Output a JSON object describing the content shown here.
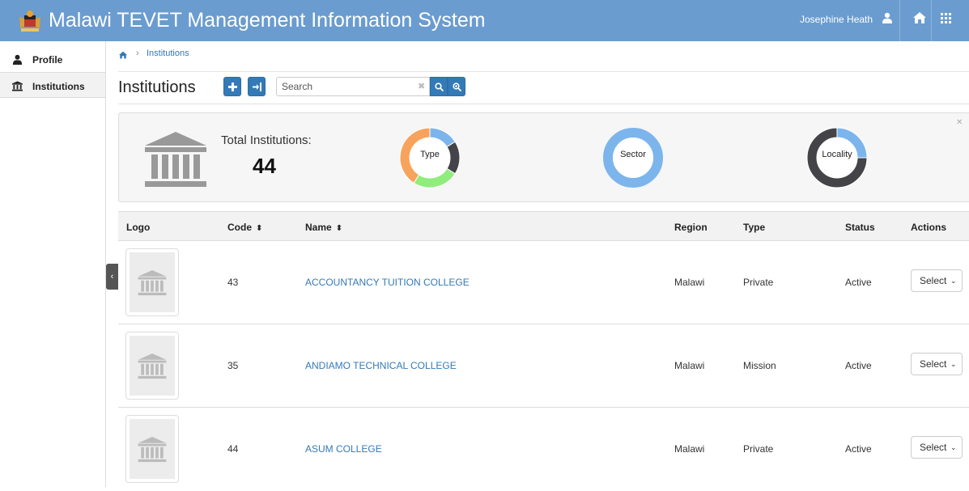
{
  "header": {
    "title": "Malawi TEVET Management Information System",
    "user_name": "Josephine Heath",
    "icons": [
      "coat-of-arms",
      "user-icon",
      "home-icon",
      "grid-icon"
    ],
    "colors": {
      "bar": "#6a9ccf",
      "link": "#337ab7"
    }
  },
  "sidebar": {
    "items": [
      {
        "label": "Profile",
        "icon": "user-icon"
      },
      {
        "label": "Institutions",
        "icon": "bank-icon",
        "active": true
      }
    ]
  },
  "breadcrumb": {
    "current": "Institutions"
  },
  "toolbar": {
    "title": "Institutions",
    "search_placeholder": "Search"
  },
  "stats": {
    "total_label": "Total Institutions:",
    "total_value": "44",
    "donuts": [
      {
        "label": "Type",
        "segments": [
          {
            "color": "#7cb5ec",
            "value": 0.16
          },
          {
            "color": "#434348",
            "value": 0.18
          },
          {
            "color": "#90ed7d",
            "value": 0.25
          },
          {
            "color": "#f7a35c",
            "value": 0.41
          }
        ]
      },
      {
        "label": "Sector",
        "segments": [
          {
            "color": "#7cb5ec",
            "value": 1.0
          }
        ]
      },
      {
        "label": "Locality",
        "segments": [
          {
            "color": "#7cb5ec",
            "value": 0.25
          },
          {
            "color": "#434348",
            "value": 0.75
          }
        ]
      }
    ]
  },
  "table": {
    "headers": {
      "logo": "Logo",
      "code": "Code",
      "name": "Name",
      "region": "Region",
      "type": "Type",
      "status": "Status",
      "actions": "Actions"
    },
    "rows": [
      {
        "code": "43",
        "name": "ACCOUNTANCY TUITION COLLEGE",
        "region": "Malawi",
        "type": "Private",
        "status": "Active",
        "action": "Select"
      },
      {
        "code": "35",
        "name": "ANDIAMO TECHNICAL COLLEGE",
        "region": "Malawi",
        "type": "Mission",
        "status": "Active",
        "action": "Select"
      },
      {
        "code": "44",
        "name": "ASUM COLLEGE",
        "region": "Malawi",
        "type": "Private",
        "status": "Active",
        "action": "Select"
      }
    ]
  }
}
